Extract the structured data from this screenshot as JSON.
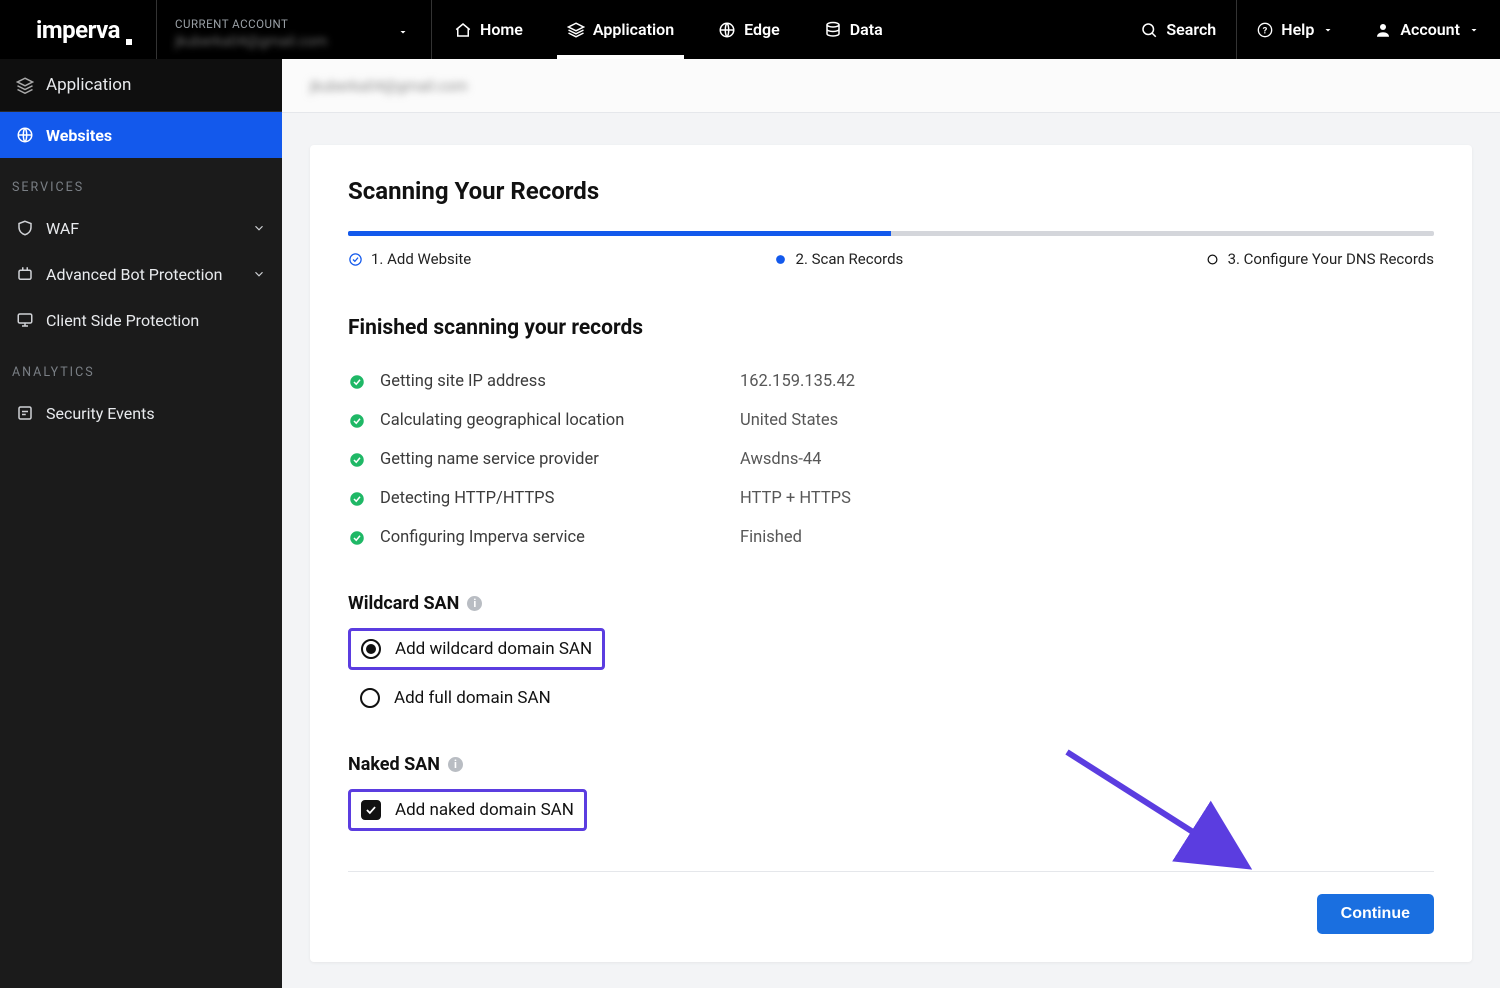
{
  "brand": "imperva",
  "account": {
    "label": "CURRENT ACCOUNT",
    "value": "jkuberka04@gmail.com"
  },
  "topnav": {
    "home": "Home",
    "application": "Application",
    "edge": "Edge",
    "data": "Data",
    "search": "Search",
    "help": "Help",
    "account": "Account"
  },
  "sidebar": {
    "header": "Application",
    "websites": "Websites",
    "services_label": "SERVICES",
    "waf": "WAF",
    "abp": "Advanced Bot Protection",
    "csp": "Client Side Protection",
    "analytics_label": "ANALYTICS",
    "security_events": "Security Events"
  },
  "breadcrumb": "jkuberka04@gmail.com",
  "page": {
    "title": "Scanning Your Records",
    "steps": {
      "s1": "1. Add Website",
      "s2": "2. Scan Records",
      "s3": "3. Configure Your DNS Records"
    },
    "finished_title": "Finished scanning your records",
    "rows": [
      {
        "k": "Getting site IP address",
        "v": "162.159.135.42"
      },
      {
        "k": "Calculating geographical location",
        "v": "United States"
      },
      {
        "k": "Getting name service provider",
        "v": "Awsdns-44"
      },
      {
        "k": "Detecting HTTP/HTTPS",
        "v": "HTTP + HTTPS"
      },
      {
        "k": "Configuring Imperva service",
        "v": "Finished"
      }
    ],
    "wildcard": {
      "title": "Wildcard SAN",
      "opt1": "Add wildcard domain SAN",
      "opt2": "Add full domain SAN"
    },
    "naked": {
      "title": "Naked SAN",
      "opt": "Add naked domain SAN"
    },
    "continue": "Continue"
  }
}
